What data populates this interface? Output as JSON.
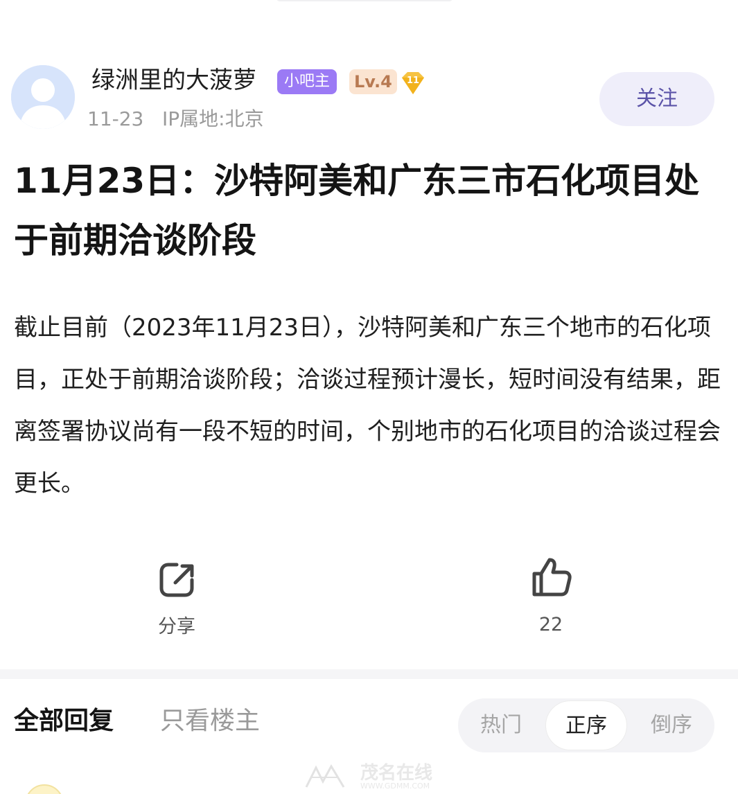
{
  "author": {
    "name": "绿洲里的大菠萝",
    "badge_owner": "小吧主",
    "badge_level": "Lv.4",
    "level_number": "11",
    "date": "11-23",
    "ip": "IP属地:北京",
    "follow_label": "关注",
    "avatar_icon": "default-user-avatar"
  },
  "post": {
    "title": "11月23日：沙特阿美和广东三市石化项目处于前期洽谈阶段",
    "body": "截止目前（2023年11月23日），沙特阿美和广东三个地市的石化项目，正处于前期洽谈阶段；洽谈过程预计漫长，短时间没有结果，距离签署协议尚有一段不短的时间，个别地市的石化项目的洽谈过程会更长。"
  },
  "actions": {
    "share_label": "分享",
    "share_icon": "share-icon",
    "like_count": "22",
    "like_icon": "thumbs-up-icon"
  },
  "replies": {
    "tab_all": "全部回复",
    "tab_owner_only": "只看楼主",
    "sort_hot": "热门",
    "sort_asc": "正序",
    "sort_desc": "倒序",
    "selected_sort": "正序"
  },
  "watermark": {
    "text": "茂名在线",
    "sub": "WWW.GDMM.COM"
  },
  "colors": {
    "owner_badge": "#9b7af5",
    "level_badge_bg": "#fbe4d1",
    "level_icon": "#f6c343",
    "follow_bg": "#efeefa",
    "follow_text": "#5b53a8"
  }
}
